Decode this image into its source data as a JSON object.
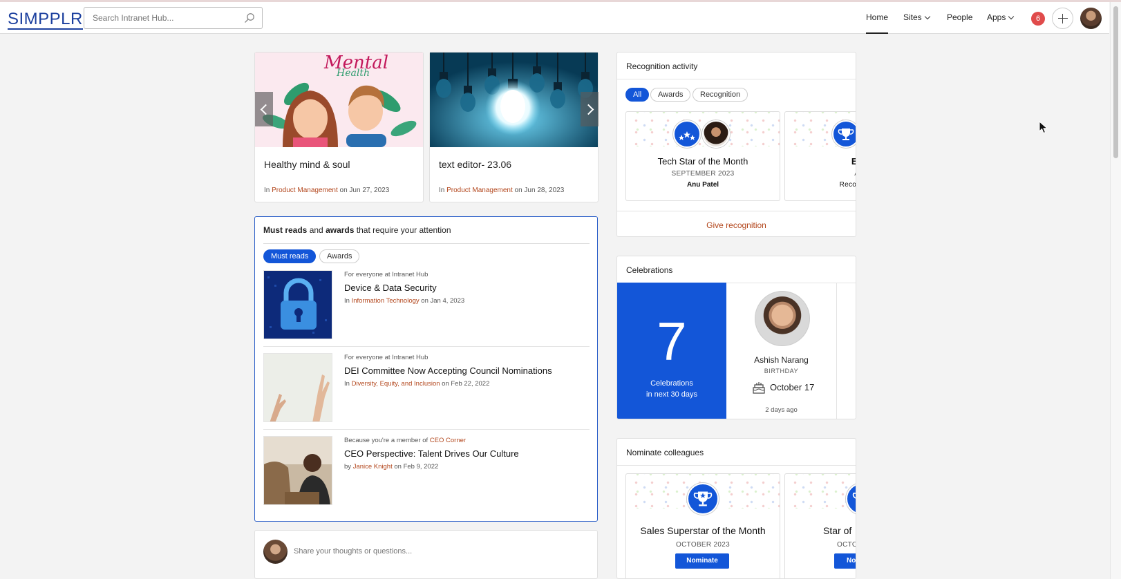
{
  "header": {
    "logo": "SIMPPLR",
    "search_placeholder": "Search Intranet Hub...",
    "nav": [
      {
        "label": "Home",
        "active": true
      },
      {
        "label": "Sites",
        "dropdown": true
      },
      {
        "label": "People"
      },
      {
        "label": "Apps",
        "dropdown": true
      }
    ],
    "notifications_count": "6"
  },
  "featured": [
    {
      "title": "Healthy mind & soul",
      "in_label": "In",
      "site": "Product Management",
      "date_label": "on Jun 27, 2023",
      "image_text": "Mental",
      "image_text2": "Health"
    },
    {
      "title": "text editor- 23.06",
      "in_label": "In",
      "site": "Product Management",
      "date_label": "on Jun 28, 2023"
    }
  ],
  "must_reads": {
    "heading_bold1": "Must reads",
    "heading_mid": " and ",
    "heading_bold2": "awards",
    "heading_end": " that require your attention",
    "tabs": [
      "Must reads",
      "Awards"
    ],
    "items": [
      {
        "audience": "For everyone at Intranet Hub",
        "title": "Device & Data Security",
        "meta_prefix": "In",
        "meta_link": "Information Technology",
        "meta_suffix": "on Jan 4, 2023"
      },
      {
        "audience": "For everyone at Intranet Hub",
        "title": "DEI Committee Now Accepting Council Nominations",
        "meta_prefix": "In",
        "meta_link": "Diversity, Equity, and Inclusion",
        "meta_suffix": "on Feb 22, 2022"
      },
      {
        "audience": "Because you're a member of",
        "audience_link": "CEO Corner",
        "title": "CEO Perspective: Talent Drives Our Culture",
        "meta_prefix": "by",
        "meta_link": "Janice Knight",
        "meta_suffix": "on Feb 9, 2022"
      }
    ]
  },
  "composer": {
    "placeholder": "Share your thoughts or questions..."
  },
  "recognition": {
    "title": "Recognition activity",
    "filters": [
      "All",
      "Awards",
      "Recognition"
    ],
    "cards": [
      {
        "title": "Tech Star of the Month",
        "period": "SEPTEMBER 2023",
        "name": "Anu Patel"
      },
      {
        "title": "Exce",
        "period": "Amb",
        "name": "Recognized b"
      }
    ],
    "give_label": "Give recognition"
  },
  "celebrations": {
    "title": "Celebrations",
    "count": "7",
    "count_label_1": "Celebrations",
    "count_label_2": "in next 30 days",
    "person": {
      "name": "Ashish Narang",
      "type": "BIRTHDAY",
      "date": "October 17",
      "ago": "2 days ago"
    }
  },
  "nominate": {
    "title": "Nominate colleagues",
    "cards": [
      {
        "title": "Sales Superstar of the Month",
        "period": "OCTOBER 2023",
        "button": "Nominate"
      },
      {
        "title": "Star of",
        "period": "OCTO",
        "button": "No"
      }
    ]
  },
  "colors": {
    "accent": "#1356d8",
    "link": "#b3471d",
    "badge": "#e04b4b"
  }
}
